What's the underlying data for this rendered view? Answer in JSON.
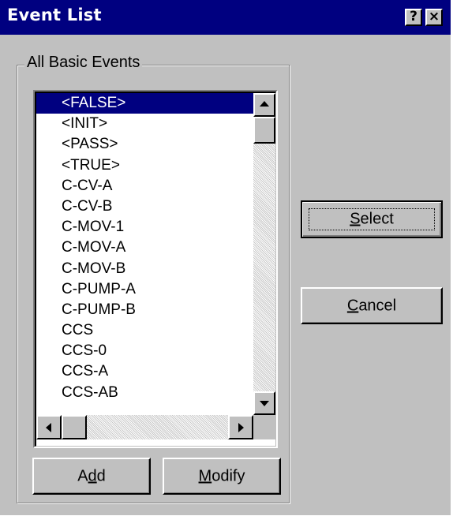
{
  "window": {
    "title": "Event List",
    "help_glyph": "?",
    "close_glyph": "×"
  },
  "group": {
    "label": "All Basic Events"
  },
  "list": {
    "selected_index": 0,
    "items": [
      "<FALSE>",
      "<INIT>",
      "<PASS>",
      "<TRUE>",
      "C-CV-A",
      "C-CV-B",
      "C-MOV-1",
      "C-MOV-A",
      "C-MOV-B",
      "C-PUMP-A",
      "C-PUMP-B",
      "CCS",
      "CCS-0",
      "CCS-A",
      "CCS-AB"
    ]
  },
  "buttons": {
    "select": {
      "pre": "",
      "mnemonic": "S",
      "post": "elect"
    },
    "cancel": {
      "pre": "",
      "mnemonic": "C",
      "post": "ancel"
    },
    "add": {
      "pre": "A",
      "mnemonic": "d",
      "post": "d"
    },
    "modify": {
      "pre": "",
      "mnemonic": "M",
      "post": "odify"
    }
  },
  "colors": {
    "titlebar": "#000080",
    "face": "#c0c0c0",
    "selection": "#000080"
  }
}
